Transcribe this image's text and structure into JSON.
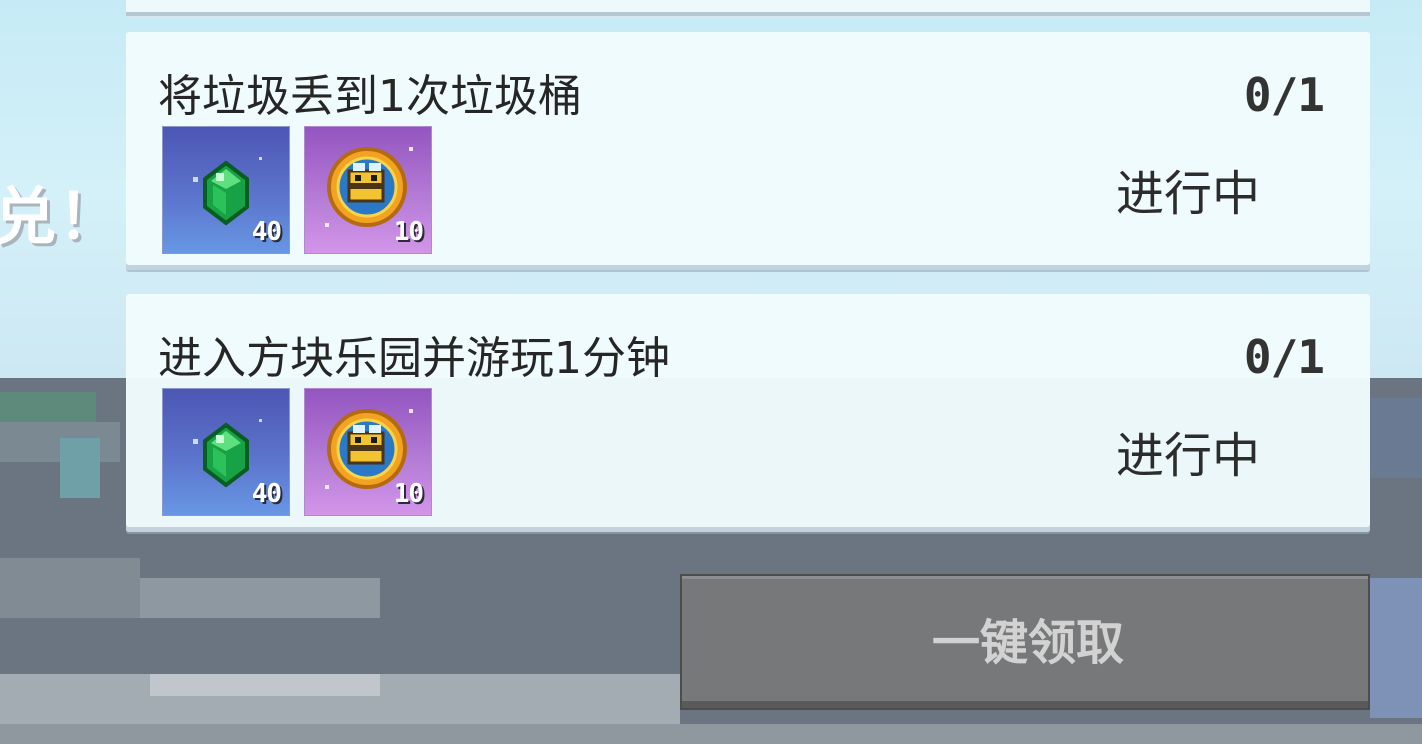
{
  "background": {
    "sky_color": "#c9ecf6",
    "ground_color": "#6b7581",
    "partial_banner_text": "兑！"
  },
  "tasks": [
    {
      "title": "将垃圾丢到1次垃圾桶",
      "progress": "0/1",
      "status": "进行中",
      "rewards": [
        {
          "icon": "emerald-icon",
          "count": "40"
        },
        {
          "icon": "bee-medal-icon",
          "count": "10"
        }
      ]
    },
    {
      "title": "进入方块乐园并游玩1分钟",
      "progress": "0/1",
      "status": "进行中",
      "rewards": [
        {
          "icon": "emerald-icon",
          "count": "40"
        },
        {
          "icon": "bee-medal-icon",
          "count": "10"
        }
      ]
    }
  ],
  "claim_all": {
    "label": "一键领取",
    "enabled": false
  },
  "colors": {
    "card_bg": "#f0fbfd",
    "emerald_tile": "#5b74cc",
    "medal_tile": "#b77ed8",
    "button_disabled": "#787878"
  }
}
